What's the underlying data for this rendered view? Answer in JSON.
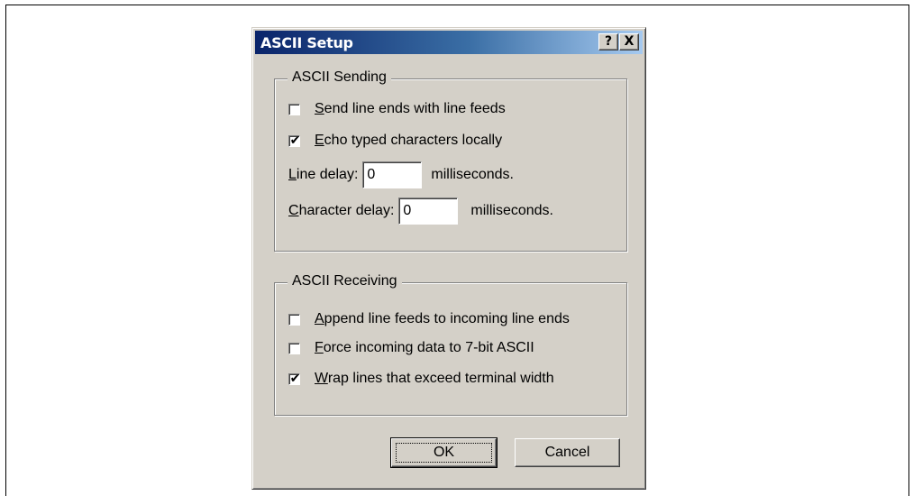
{
  "dialog": {
    "title": "ASCII Setup",
    "help_label": "?",
    "close_label": "X"
  },
  "sending": {
    "label": "ASCII Sending",
    "send_line_ends": {
      "prefix": "",
      "accel": "S",
      "rest": "end line ends with line feeds",
      "checked": false
    },
    "echo_typed": {
      "prefix": "",
      "accel": "E",
      "rest": "cho typed characters locally",
      "checked": true
    },
    "line_delay": {
      "accel": "L",
      "rest": "ine delay:",
      "value": "0",
      "unit": "milliseconds."
    },
    "char_delay": {
      "accel": "C",
      "rest": "haracter delay:",
      "value": "0",
      "unit": "milliseconds."
    }
  },
  "receiving": {
    "label": "ASCII Receiving",
    "append_line_feeds": {
      "accel": "A",
      "rest": "ppend line feeds to incoming line ends",
      "checked": false
    },
    "force_7bit": {
      "accel": "F",
      "rest": "orce incoming data to 7-bit ASCII",
      "checked": false
    },
    "wrap_lines": {
      "accel": "W",
      "rest": "rap lines that exceed terminal width",
      "checked": true
    }
  },
  "buttons": {
    "ok": "OK",
    "cancel": "Cancel"
  },
  "check_glyph": "✔"
}
